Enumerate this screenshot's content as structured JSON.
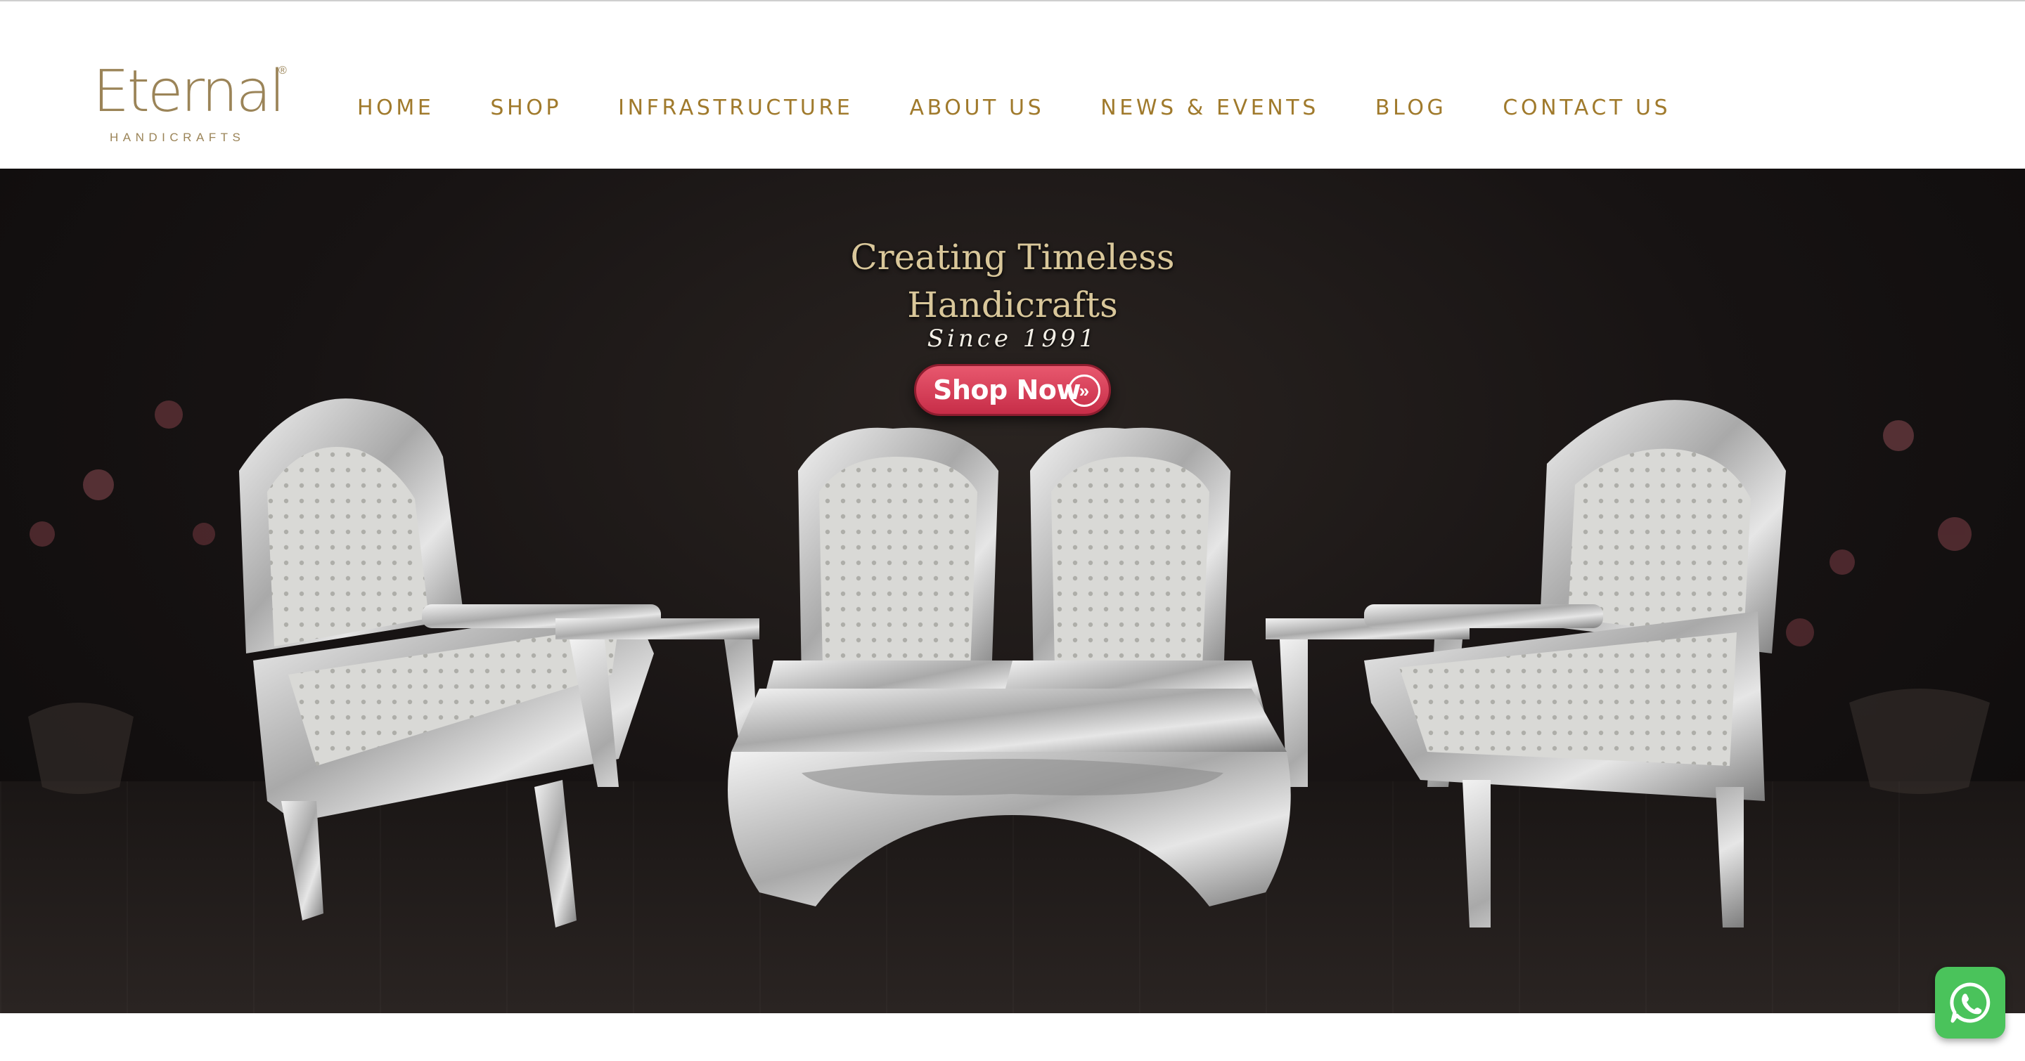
{
  "brand": {
    "name": "Eternal",
    "registered_mark": "®",
    "tagline": "HANDICRAFTS",
    "color": "#9b8458"
  },
  "nav": {
    "color": "#a07a2c",
    "items": [
      {
        "label": "HOME"
      },
      {
        "label": "SHOP"
      },
      {
        "label": "INFRASTRUCTURE"
      },
      {
        "label": "ABOUT US"
      },
      {
        "label": "NEWS & EVENTS"
      },
      {
        "label": "BLOG"
      },
      {
        "label": "CONTACT US"
      }
    ]
  },
  "hero": {
    "headline_line1": "Creating Timeless",
    "headline_line2": "Handicrafts",
    "since": "Since 1991",
    "cta_label": "Shop Now",
    "cta_icon": "double-chevron-right-icon",
    "cta_color": "#d93b55",
    "image_subject": "silver carved furniture set"
  },
  "whatsapp": {
    "icon": "whatsapp-icon",
    "color": "#4ac35b"
  }
}
